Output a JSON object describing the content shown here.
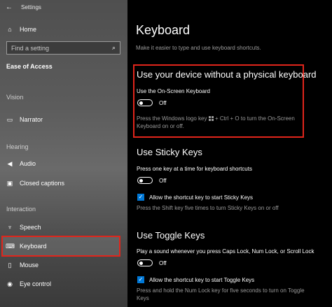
{
  "window": {
    "title": "Settings",
    "back_icon": "back-arrow-icon"
  },
  "sidebar": {
    "home": {
      "label": "Home",
      "icon": "home-icon"
    },
    "search": {
      "placeholder": "Find a setting",
      "icon": "search-icon"
    },
    "category_title": "Ease of Access",
    "sections": {
      "vision": "Vision",
      "hearing": "Hearing",
      "interaction": "Interaction"
    },
    "items": {
      "narrator": {
        "label": "Narrator",
        "icon": "narrator-icon"
      },
      "audio": {
        "label": "Audio",
        "icon": "audio-icon"
      },
      "closed_captions": {
        "label": "Closed captions",
        "icon": "closed-captions-icon"
      },
      "speech": {
        "label": "Speech",
        "icon": "microphone-icon"
      },
      "keyboard": {
        "label": "Keyboard",
        "icon": "keyboard-icon",
        "selected": true
      },
      "mouse": {
        "label": "Mouse",
        "icon": "mouse-icon"
      },
      "eye_control": {
        "label": "Eye control",
        "icon": "eye-icon"
      }
    }
  },
  "main": {
    "title": "Keyboard",
    "subtitle": "Make it easier to type and use keyboard shortcuts.",
    "osk": {
      "heading": "Use your device without a physical keyboard",
      "toggle_label": "Use the On-Screen Keyboard",
      "toggle_state": "Off",
      "hint_part1": "Press the Windows logo key",
      "hint_part2": "+ Ctrl + O to turn the On-Screen",
      "hint_part3": "Keyboard on or off."
    },
    "sticky": {
      "heading": "Use Sticky Keys",
      "toggle_label": "Press one key at a time for keyboard shortcuts",
      "toggle_state": "Off",
      "checkbox_label": "Allow the shortcut key to start Sticky Keys",
      "checkbox_checked": true,
      "hint": "Press the Shift key five times to turn Sticky Keys on or off"
    },
    "toggle_keys": {
      "heading": "Use Toggle Keys",
      "toggle_label": "Play a sound whenever you press Caps Lock, Num Lock, or Scroll Lock",
      "toggle_state": "Off",
      "checkbox_label": "Allow the shortcut key to start Toggle Keys",
      "checkbox_checked": true,
      "hint_line1": "Press and hold the Num Lock key for five seconds to turn on Toggle",
      "hint_line2": "Keys"
    }
  },
  "colors": {
    "accent": "#0078d7",
    "highlight_red": "#e1251b",
    "muted_text": "#9a9a9a"
  }
}
